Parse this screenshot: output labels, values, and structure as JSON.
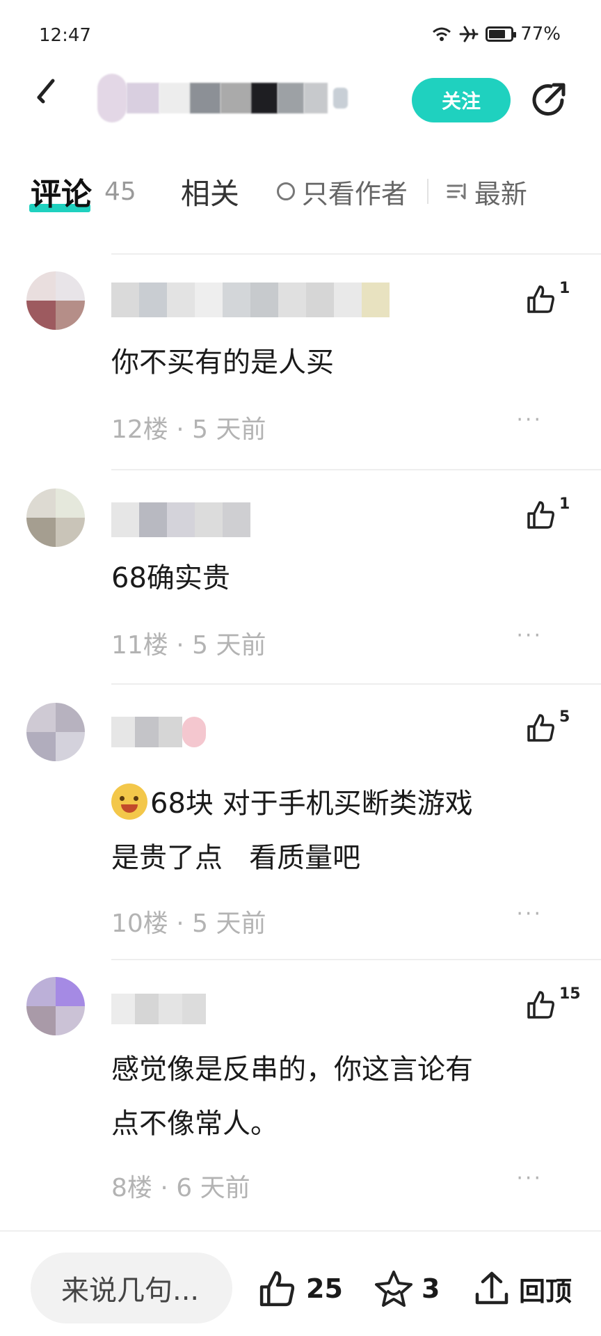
{
  "status_bar": {
    "time": "12:47",
    "battery": "77%",
    "battery_level": 0.77
  },
  "header": {
    "follow_label": "关注"
  },
  "tabs": {
    "comments_label": "评论",
    "comments_count": "45",
    "related_label": "相关",
    "author_only_label": "只看作者",
    "sort_label": "最新"
  },
  "comments": [
    {
      "text": "你不买有的是人买",
      "floor": "12楼",
      "time": "5 天前",
      "likes": "1"
    },
    {
      "text": "68确实贵",
      "floor": "11楼",
      "time": "5 天前",
      "likes": "1"
    },
    {
      "text_line1": "68块 对于手机买断类游戏",
      "text_line2": "是贵了点   看质量吧",
      "floor": "10楼",
      "time": "5 天前",
      "likes": "5"
    },
    {
      "text_line1": "感觉像是反串的，你这言论有",
      "text_line2": "点不像常人。",
      "floor": "8楼",
      "time": "6 天前",
      "likes": "15"
    }
  ],
  "bottom_bar": {
    "input_placeholder": "来说几句...",
    "like_count": "25",
    "favorite_count": "3",
    "back_to_top_label": "回顶"
  },
  "colors": {
    "accent": "#1fd1bf",
    "meta_gray": "#b3b3b3"
  }
}
